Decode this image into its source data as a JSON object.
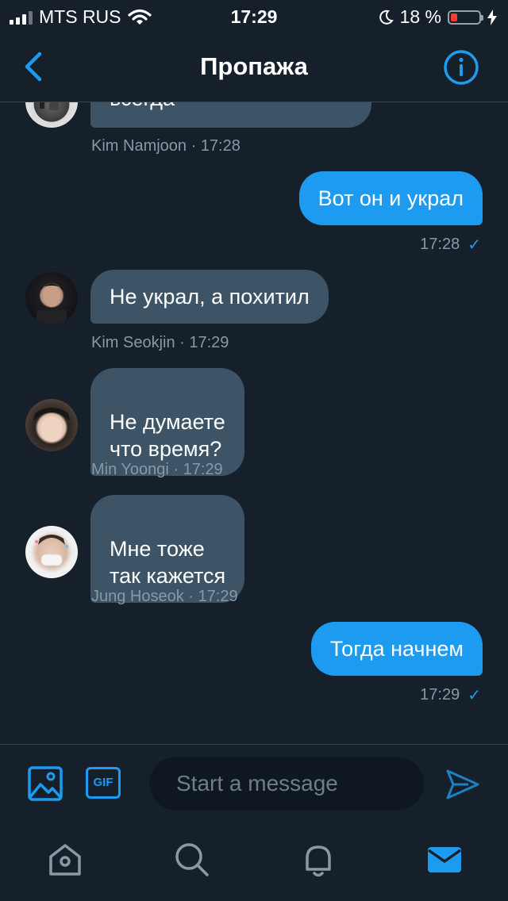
{
  "status": {
    "carrier": "MTS RUS",
    "time": "17:29",
    "battery": "18 %"
  },
  "header": {
    "title": "Пропажа"
  },
  "messages": [
    {
      "text": "всегда",
      "meta": "Kim Namjoon · 17:28"
    },
    {
      "text": "Вот он и украл",
      "meta": "17:28"
    },
    {
      "text": "Не украл, а похитил",
      "meta": "Kim Seokjin · 17:29"
    },
    {
      "text": "Не думаете\nчто время?",
      "meta": "Min Yoongi · 17:29"
    },
    {
      "text": "Мне тоже\nтак кажется",
      "meta": "Jung Hoseok · 17:29"
    },
    {
      "text": "Тогда начнем",
      "meta": "17:29"
    }
  ],
  "composer": {
    "placeholder": "Start a message",
    "gif_label": "GIF"
  },
  "colors": {
    "background": "#15202b",
    "accent": "#1d9bf0",
    "incoming_bubble": "#3d5466",
    "muted_text": "#8899a6"
  },
  "icons": {
    "back": "chevron-left-icon",
    "info": "info-icon",
    "image": "image-icon",
    "send": "send-icon",
    "home": "home-icon",
    "search": "search-icon",
    "notifications": "bell-icon",
    "messages": "mail-icon"
  }
}
